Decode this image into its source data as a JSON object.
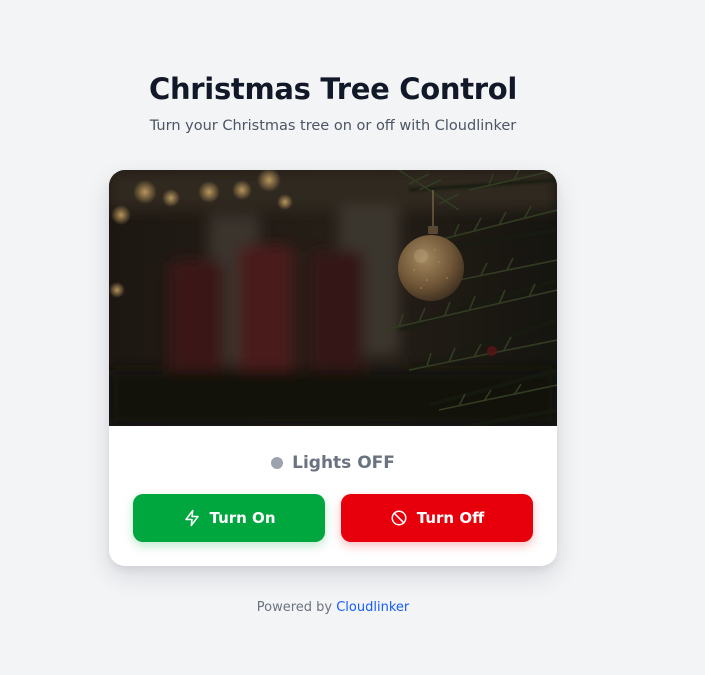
{
  "page": {
    "title": "Christmas Tree Control",
    "subtitle": "Turn your Christmas tree on or off with Cloudlinker"
  },
  "card": {
    "image_icon": "christmas-ornament-photo",
    "status": {
      "text": "Lights OFF",
      "dot_color": "#9ca3af"
    },
    "buttons": {
      "on": {
        "label": "Turn On",
        "icon": "lightning-icon",
        "color": "#00a63e"
      },
      "off": {
        "label": "Turn Off",
        "icon": "prohibited-icon",
        "color": "#e7000b"
      }
    }
  },
  "footer": {
    "prefix": "Powered by",
    "link_text": "Cloudlinker",
    "link_color": "#155dfc"
  }
}
